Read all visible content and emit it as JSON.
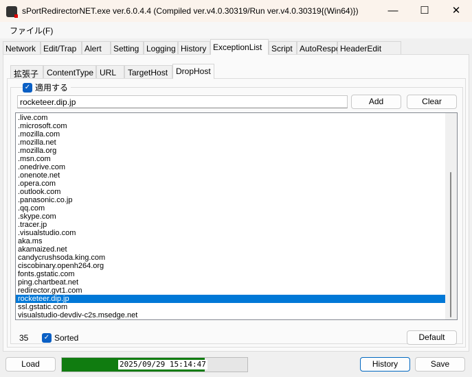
{
  "window": {
    "title": "sPortRedirectorNET.exe ver.6.0.4.4 (Compiled ver.v4.0.30319/Run ver.v4.0.30319{(Win64)})",
    "minimize": "—",
    "maximize": "☐",
    "close": "✕"
  },
  "menu": {
    "file": "ファイル(F)"
  },
  "tabs": [
    "Network",
    "Edit/Trap",
    "Alert",
    "Setting",
    "Logging",
    "History",
    "ExceptionList",
    "Script",
    "AutoResponse",
    "HeaderEdit"
  ],
  "inner_tabs": [
    "拡張子",
    "ContentType",
    "URL",
    "TargetHost",
    "DropHost"
  ],
  "drophost": {
    "apply_label": "適用する",
    "apply_checked": true,
    "input_value": "rocketeer.dip.jp",
    "add_label": "Add",
    "clear_label": "Clear",
    "items": [
      ".live.com",
      ".microsoft.com",
      ".mozilla.com",
      ".mozilla.net",
      ".mozilla.org",
      ".msn.com",
      ".onedrive.com",
      ".onenote.net",
      ".opera.com",
      ".outlook.com",
      ".panasonic.co.jp",
      ".qq.com",
      ".skype.com",
      ".tracer.jp",
      ".visualstudio.com",
      "aka.ms",
      "akamaized.net",
      "candycrushsoda.king.com",
      "ciscobinary.openh264.org",
      "fonts.gstatic.com",
      "ping.chartbeat.net",
      "redirector.gvt1.com",
      "rocketeer.dip.jp",
      "ssl.gstatic.com",
      "visualstudio-devdiv-c2s.msedge.net"
    ],
    "selected_index": 22,
    "count": "35",
    "sorted_label": "Sorted",
    "sorted_checked": true,
    "default_label": "Default"
  },
  "bottom": {
    "load_label": "Load",
    "progress_text": "2025/09/29 15:14:47",
    "progress_fraction": 0.77,
    "history_label": "History",
    "save_label": "Save"
  },
  "colors": {
    "progress": "#107c10",
    "selection": "#0078d7",
    "checkbox": "#0a5fc4"
  }
}
